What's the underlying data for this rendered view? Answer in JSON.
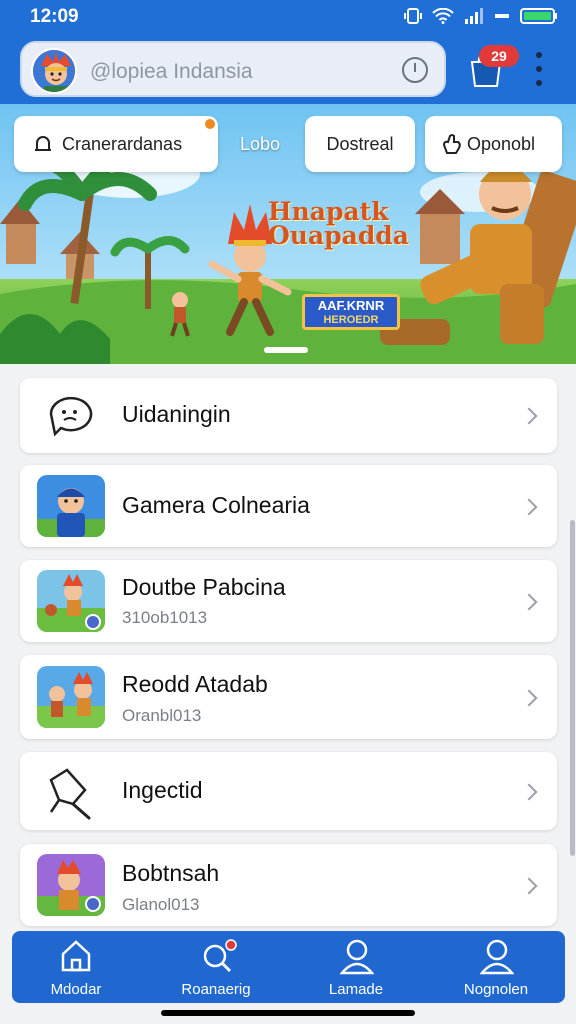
{
  "status_bar": {
    "time": "12:09"
  },
  "header": {
    "search_placeholder": "@lopiea Indansia",
    "notification_count": "29",
    "colors": {
      "header_bg": "#1f6fd6",
      "badge": "#e03a3a"
    }
  },
  "banner": {
    "chips": [
      {
        "label": "Cranerardanas",
        "icon": "bell-icon"
      },
      {
        "label": "Lobo",
        "icon": ""
      },
      {
        "label": "Dostreal",
        "icon": ""
      },
      {
        "label": "Oponobl",
        "icon": "hand-icon"
      }
    ],
    "title_line1": "Hnapatk",
    "title_line2": "Ouapadda",
    "sign_line1": "AAF.KRNR",
    "sign_line2": "HEROEDR"
  },
  "list": {
    "items": [
      {
        "title": "Uidaningin",
        "subtitle": "",
        "icon": "chat-bubble-icon"
      },
      {
        "title": "Gamera Colnearia",
        "subtitle": "",
        "icon": "game-thumbnail"
      },
      {
        "title": "Doutbe Pabcina",
        "subtitle": "310ob1013",
        "icon": "game-thumbnail"
      },
      {
        "title": "Reodd Atadab",
        "subtitle": "Oranbl013",
        "icon": "game-thumbnail"
      },
      {
        "title": "Ingectid",
        "subtitle": "",
        "icon": "pen-icon"
      },
      {
        "title": "Bobtnsah",
        "subtitle": "Glanol013",
        "icon": "game-thumbnail"
      }
    ]
  },
  "bottom_nav": {
    "items": [
      {
        "label": "Mdodar",
        "icon": "home-icon"
      },
      {
        "label": "Roanaerig",
        "icon": "search-icon"
      },
      {
        "label": "Lamade",
        "icon": "person-icon"
      },
      {
        "label": "Nognolen",
        "icon": "profile-icon"
      }
    ],
    "colors": {
      "bg": "#2068cf"
    }
  }
}
